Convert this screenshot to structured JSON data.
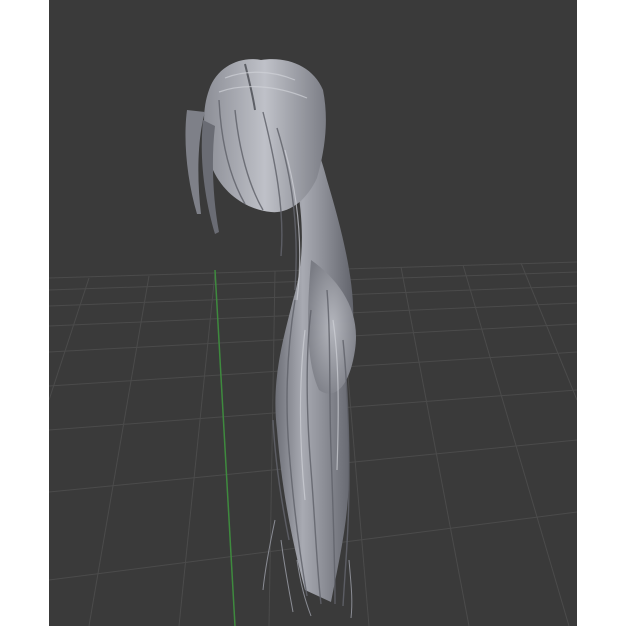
{
  "viewport": {
    "background_color": "#3a3a3a",
    "grid_color": "#4b4b4b",
    "y_axis_color": "#3e8a3e",
    "mesh_color": "#9a9ca4",
    "mesh_highlight_color": "#c9cbd2",
    "mesh_shadow_color": "#5d5f66",
    "object": "long-hair-mesh"
  }
}
